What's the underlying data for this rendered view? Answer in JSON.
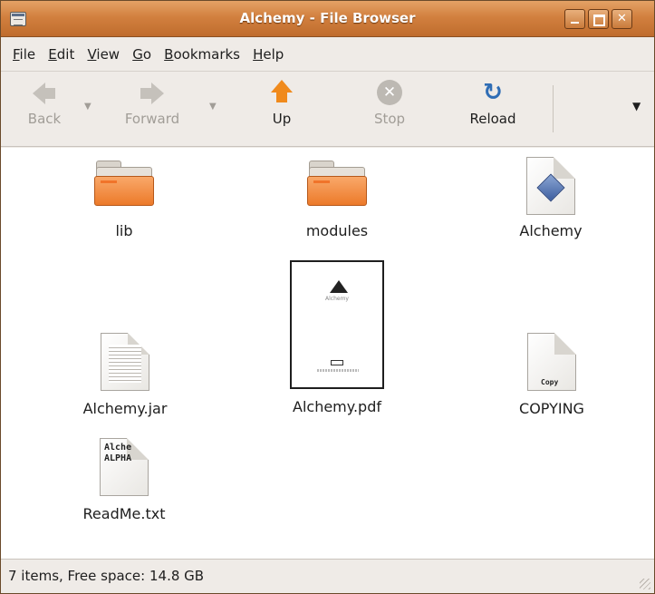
{
  "window": {
    "title": "Alchemy - File Browser"
  },
  "menubar": {
    "items": [
      {
        "mnemonic": "F",
        "rest": "ile"
      },
      {
        "mnemonic": "E",
        "rest": "dit"
      },
      {
        "mnemonic": "V",
        "rest": "iew"
      },
      {
        "mnemonic": "G",
        "rest": "o"
      },
      {
        "mnemonic": "B",
        "rest": "ookmarks"
      },
      {
        "mnemonic": "H",
        "rest": "elp"
      }
    ]
  },
  "toolbar": {
    "back_label": "Back",
    "forward_label": "Forward",
    "up_label": "Up",
    "stop_label": "Stop",
    "reload_label": "Reload",
    "back_enabled": false,
    "forward_enabled": false,
    "up_enabled": true,
    "stop_enabled": false,
    "reload_enabled": true
  },
  "files": [
    {
      "name": "lib",
      "type": "folder",
      "icon": "folder-icon"
    },
    {
      "name": "modules",
      "type": "folder",
      "icon": "folder-icon"
    },
    {
      "name": "Alchemy",
      "type": "executable",
      "icon": "executable-icon"
    },
    {
      "name": "Alchemy.jar",
      "type": "archive",
      "icon": "jar-file-icon"
    },
    {
      "name": "Alchemy.pdf",
      "type": "pdf",
      "icon": "pdf-thumbnail-icon",
      "preview_text": "Alchemy"
    },
    {
      "name": "COPYING",
      "type": "text",
      "icon": "text-file-icon",
      "preview_text": "Copy"
    },
    {
      "name": "ReadMe.txt",
      "type": "text",
      "icon": "text-file-icon",
      "preview_lines": [
        "Alche",
        "ALPHA"
      ]
    }
  ],
  "statusbar": {
    "text": "7 items, Free space: 14.8 GB"
  },
  "colors": {
    "titlebar": "#d2803f",
    "folder": "#ec7a2a",
    "up_arrow": "#f08a1c",
    "reload": "#2f6db5",
    "window_bg": "#efebe7"
  }
}
